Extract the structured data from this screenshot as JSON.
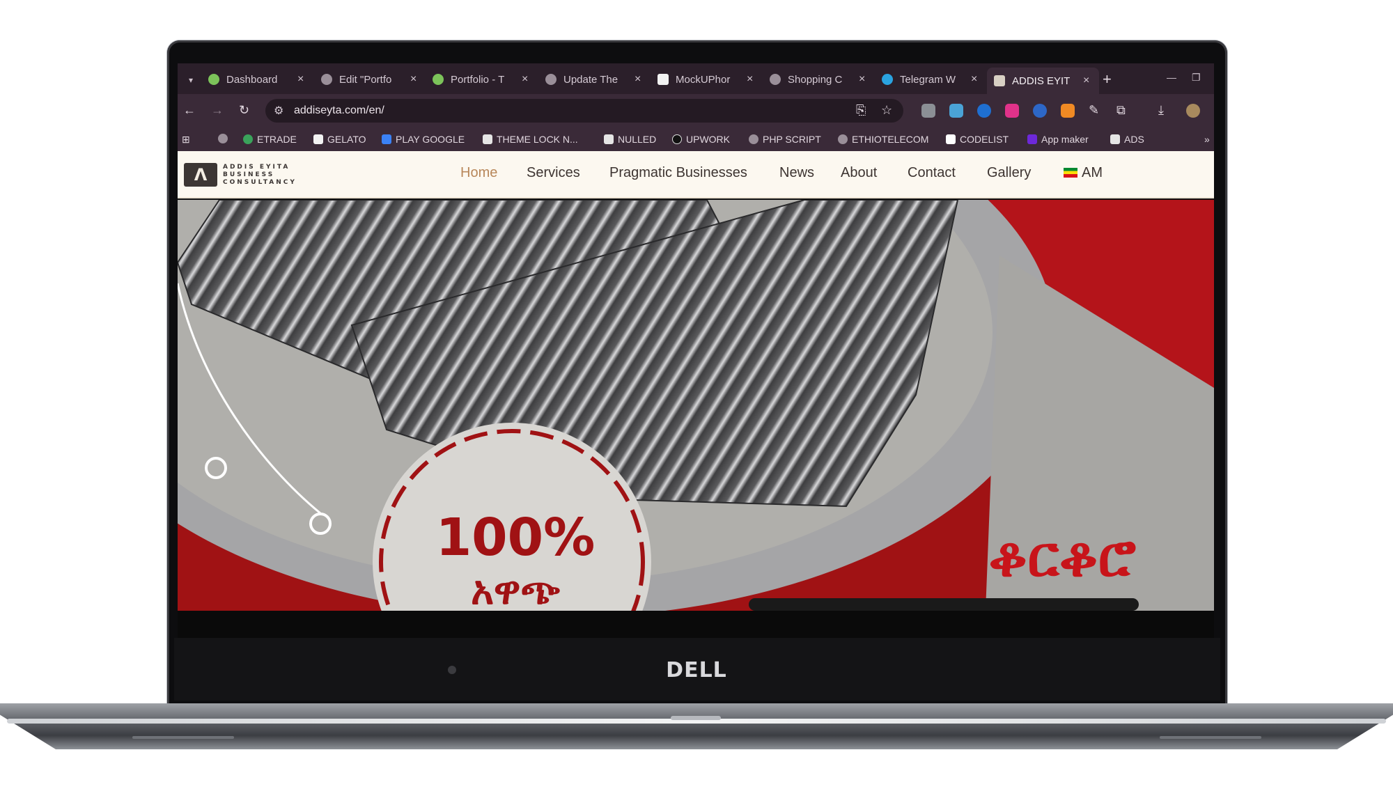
{
  "device": {
    "brand": "DELL"
  },
  "browser": {
    "tabs": [
      {
        "label": "Dashboard",
        "favicon": "stack-icon",
        "color": "#7cc35a"
      },
      {
        "label": "Edit \"Portfo",
        "favicon": "globe-icon",
        "color": "#9a8f99"
      },
      {
        "label": "Portfolio - T",
        "favicon": "stack-icon",
        "color": "#7cc35a"
      },
      {
        "label": "Update The",
        "favicon": "globe-icon",
        "color": "#9a8f99"
      },
      {
        "label": "MockUPhor",
        "favicon": "mockup-icon",
        "color": "#f2f2f2"
      },
      {
        "label": "Shopping C",
        "favicon": "globe-icon",
        "color": "#9a8f99"
      },
      {
        "label": "Telegram W",
        "favicon": "telegram-icon",
        "color": "#2aa3e0"
      },
      {
        "label": "ADDIS EYIT",
        "favicon": "addis-icon",
        "color": "#d8d0c4",
        "active": true
      }
    ],
    "address": "addiseyta.com/en/",
    "bookmarks": [
      {
        "label": "ETRADE",
        "color": "#3aa35b"
      },
      {
        "label": "GELATO",
        "color": "#f2f2f2"
      },
      {
        "label": "PLAY GOOGLE",
        "color": "#3b82f6"
      },
      {
        "label": "THEME LOCK N...",
        "color": "#e5e5e5"
      },
      {
        "label": "NULLED",
        "color": "#e5e5e5"
      },
      {
        "label": "UPWORK",
        "color": "#111111"
      },
      {
        "label": "PHP SCRIPT",
        "color": "#9a8f99"
      },
      {
        "label": "ETHIOTELECOM",
        "color": "#9a8f99"
      },
      {
        "label": "CODELIST",
        "color": "#ffffff"
      },
      {
        "label": "App maker",
        "color": "#6d28d9"
      },
      {
        "label": "ADS",
        "color": "#e5e5e5"
      }
    ]
  },
  "site": {
    "logo": {
      "mark": "Λ",
      "line1": "ADDIS EYITA",
      "line2": "BUSINESS",
      "line3": "CONSULTANCY"
    },
    "menu": [
      "Home",
      "Services",
      "Pragmatic Businesses",
      "News",
      "About",
      "Contact",
      "Gallery",
      "AM"
    ],
    "hero": {
      "stamp_top": "100%",
      "stamp_bottom": "አዋጭ",
      "headline": "ቆርቆሮ"
    }
  },
  "colors": {
    "accent": "#b8875a",
    "hero_red": "#a01214",
    "chrome": "#3a2a38"
  }
}
